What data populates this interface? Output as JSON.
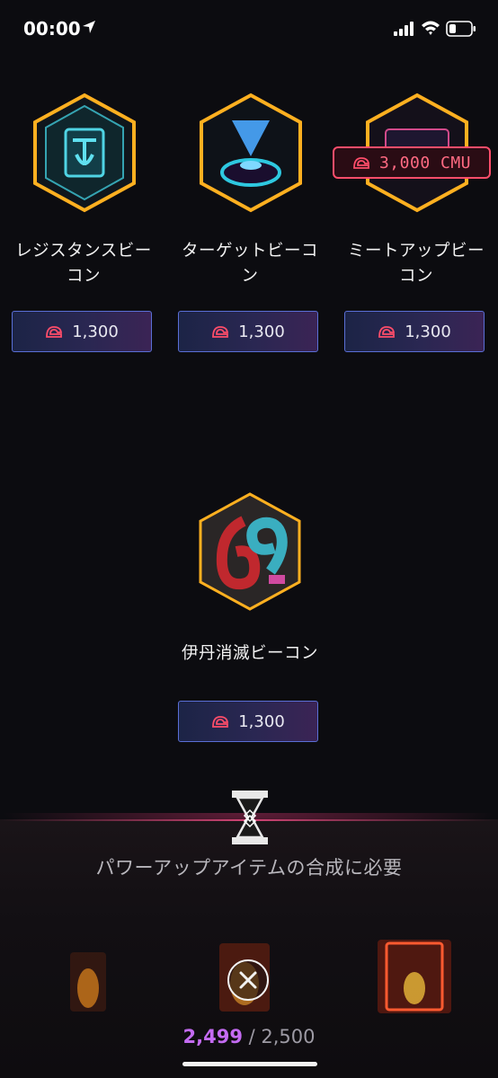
{
  "status_bar": {
    "time": "00:00"
  },
  "currency_unit": "CMU",
  "colors": {
    "accent_pink": "#ff4d6a",
    "inventory_purple": "#c46bf2",
    "button_border": "#5a6fd6"
  },
  "beacons": [
    {
      "name": "レジスタンスビーコン",
      "price": "1,300",
      "icon": "resistance-beacon-icon"
    },
    {
      "name": "ターゲットビーコン",
      "price": "1,300",
      "icon": "target-beacon-icon"
    },
    {
      "name": "ミートアップビーコン",
      "price": "1,300",
      "icon": "meetup-beacon-icon",
      "tag": "3,000 CMU"
    },
    {
      "name": "伊丹消滅ビーコン",
      "price": "1,300",
      "icon": "itami-69-beacon-icon"
    }
  ],
  "footer": {
    "requirement": "パワーアップアイテムの合成に必要",
    "inventory_current": "2,499",
    "inventory_separator": " / ",
    "inventory_max": "2,500"
  }
}
